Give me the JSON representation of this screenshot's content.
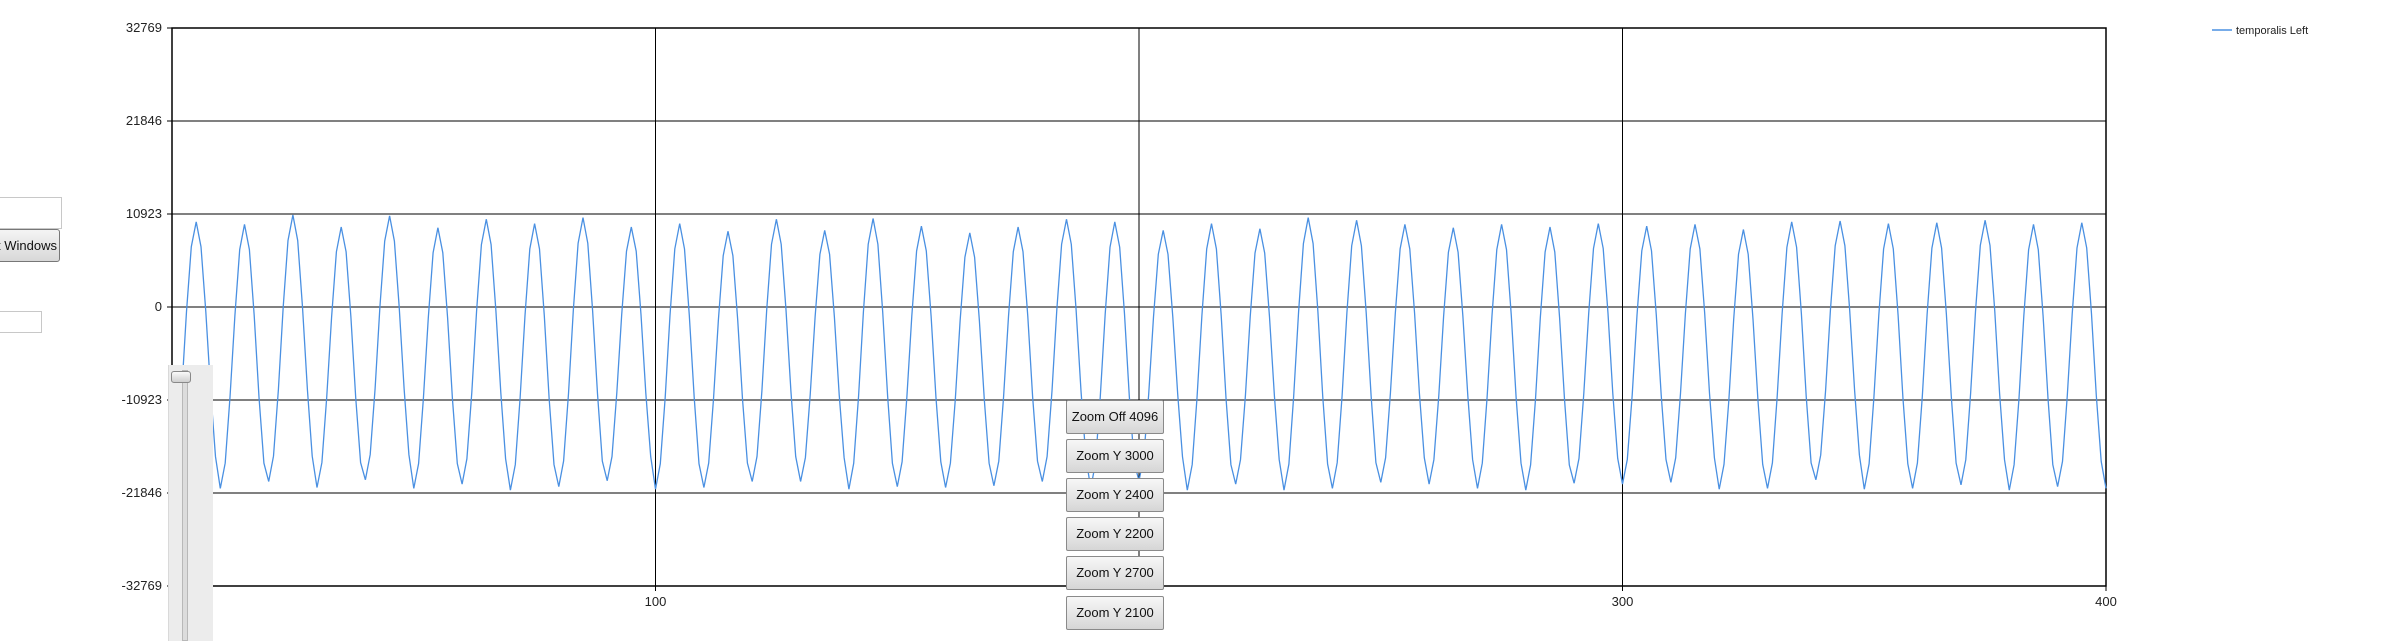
{
  "chart_data": {
    "type": "line",
    "ylim": [
      -32769,
      32769
    ],
    "xlim": [
      0,
      400
    ],
    "y_ticks": [
      "32769",
      "21846",
      "10923",
      "0",
      "-10923",
      "-21846",
      "-32769"
    ],
    "y_tick_values": [
      32769,
      21846,
      10923,
      0,
      -10923,
      -21846,
      -32769
    ],
    "x_ticks": [
      "100",
      "300",
      "400"
    ],
    "x_tick_values": [
      100,
      300,
      400
    ],
    "grid": true,
    "legend_position": "top-right",
    "series": [
      {
        "name": "temporalis Left",
        "color": "#4a90e2",
        "period": 10,
        "peaks": [
          10000,
          9700,
          10800,
          9400,
          10700,
          9300,
          10300,
          9800,
          10500,
          9400,
          9800,
          8900,
          10300,
          9000,
          10400,
          9500,
          8700,
          9400,
          10300,
          10000,
          9000,
          9800,
          9200,
          10500,
          10200,
          9700,
          9300,
          9700,
          9400,
          9800,
          9500,
          9700,
          9100,
          10000,
          10100,
          9800,
          9900,
          10200,
          9700,
          9900,
          10200,
          9600,
          10000
        ],
        "troughs": [
          -20500,
          -21300,
          -20500,
          -21200,
          -20300,
          -21300,
          -20800,
          -21500,
          -21100,
          -20400,
          -21400,
          -21200,
          -20500,
          -20500,
          -21400,
          -21100,
          -21200,
          -21000,
          -20500,
          -21300,
          -20400,
          -21500,
          -20800,
          -21500,
          -21300,
          -20600,
          -20800,
          -21300,
          -21500,
          -20700,
          -20800,
          -20600,
          -21400,
          -21300,
          -20300,
          -21400,
          -21300,
          -20900,
          -21500,
          -21100,
          -21300,
          -20700
        ]
      }
    ]
  },
  "left_panel": {
    "button_label": "t Windows"
  },
  "zoom_menu": [
    "Zoom Off 4096",
    "Zoom Y 3000",
    "Zoom Y 2400",
    "Zoom Y 2200",
    "Zoom Y 2700",
    "Zoom Y 2100"
  ]
}
